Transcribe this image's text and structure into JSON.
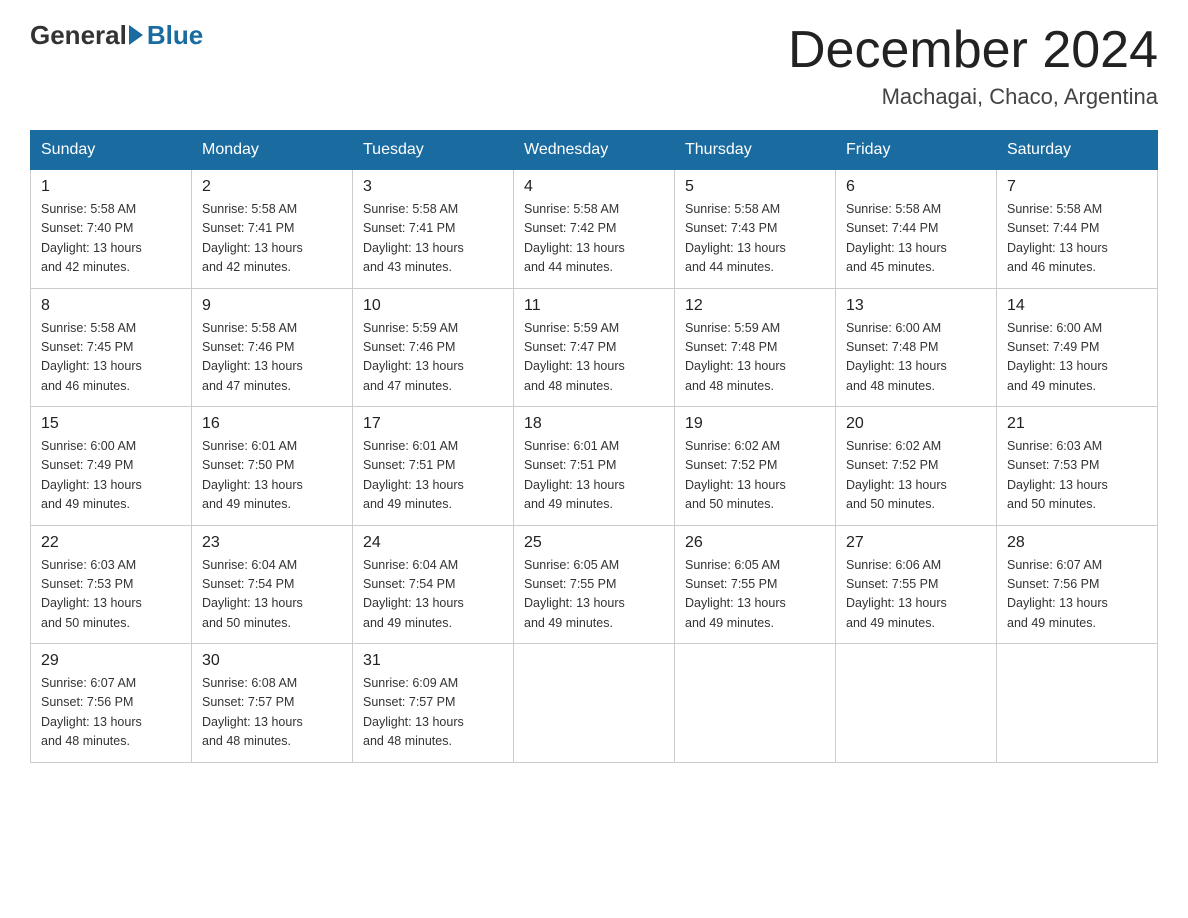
{
  "logo": {
    "general": "General",
    "blue": "Blue"
  },
  "title": {
    "month_year": "December 2024",
    "location": "Machagai, Chaco, Argentina"
  },
  "weekdays": [
    "Sunday",
    "Monday",
    "Tuesday",
    "Wednesday",
    "Thursday",
    "Friday",
    "Saturday"
  ],
  "weeks": [
    [
      {
        "day": "1",
        "sunrise": "5:58 AM",
        "sunset": "7:40 PM",
        "daylight": "13 hours and 42 minutes."
      },
      {
        "day": "2",
        "sunrise": "5:58 AM",
        "sunset": "7:41 PM",
        "daylight": "13 hours and 42 minutes."
      },
      {
        "day": "3",
        "sunrise": "5:58 AM",
        "sunset": "7:41 PM",
        "daylight": "13 hours and 43 minutes."
      },
      {
        "day": "4",
        "sunrise": "5:58 AM",
        "sunset": "7:42 PM",
        "daylight": "13 hours and 44 minutes."
      },
      {
        "day": "5",
        "sunrise": "5:58 AM",
        "sunset": "7:43 PM",
        "daylight": "13 hours and 44 minutes."
      },
      {
        "day": "6",
        "sunrise": "5:58 AM",
        "sunset": "7:44 PM",
        "daylight": "13 hours and 45 minutes."
      },
      {
        "day": "7",
        "sunrise": "5:58 AM",
        "sunset": "7:44 PM",
        "daylight": "13 hours and 46 minutes."
      }
    ],
    [
      {
        "day": "8",
        "sunrise": "5:58 AM",
        "sunset": "7:45 PM",
        "daylight": "13 hours and 46 minutes."
      },
      {
        "day": "9",
        "sunrise": "5:58 AM",
        "sunset": "7:46 PM",
        "daylight": "13 hours and 47 minutes."
      },
      {
        "day": "10",
        "sunrise": "5:59 AM",
        "sunset": "7:46 PM",
        "daylight": "13 hours and 47 minutes."
      },
      {
        "day": "11",
        "sunrise": "5:59 AM",
        "sunset": "7:47 PM",
        "daylight": "13 hours and 48 minutes."
      },
      {
        "day": "12",
        "sunrise": "5:59 AM",
        "sunset": "7:48 PM",
        "daylight": "13 hours and 48 minutes."
      },
      {
        "day": "13",
        "sunrise": "6:00 AM",
        "sunset": "7:48 PM",
        "daylight": "13 hours and 48 minutes."
      },
      {
        "day": "14",
        "sunrise": "6:00 AM",
        "sunset": "7:49 PM",
        "daylight": "13 hours and 49 minutes."
      }
    ],
    [
      {
        "day": "15",
        "sunrise": "6:00 AM",
        "sunset": "7:49 PM",
        "daylight": "13 hours and 49 minutes."
      },
      {
        "day": "16",
        "sunrise": "6:01 AM",
        "sunset": "7:50 PM",
        "daylight": "13 hours and 49 minutes."
      },
      {
        "day": "17",
        "sunrise": "6:01 AM",
        "sunset": "7:51 PM",
        "daylight": "13 hours and 49 minutes."
      },
      {
        "day": "18",
        "sunrise": "6:01 AM",
        "sunset": "7:51 PM",
        "daylight": "13 hours and 49 minutes."
      },
      {
        "day": "19",
        "sunrise": "6:02 AM",
        "sunset": "7:52 PM",
        "daylight": "13 hours and 50 minutes."
      },
      {
        "day": "20",
        "sunrise": "6:02 AM",
        "sunset": "7:52 PM",
        "daylight": "13 hours and 50 minutes."
      },
      {
        "day": "21",
        "sunrise": "6:03 AM",
        "sunset": "7:53 PM",
        "daylight": "13 hours and 50 minutes."
      }
    ],
    [
      {
        "day": "22",
        "sunrise": "6:03 AM",
        "sunset": "7:53 PM",
        "daylight": "13 hours and 50 minutes."
      },
      {
        "day": "23",
        "sunrise": "6:04 AM",
        "sunset": "7:54 PM",
        "daylight": "13 hours and 50 minutes."
      },
      {
        "day": "24",
        "sunrise": "6:04 AM",
        "sunset": "7:54 PM",
        "daylight": "13 hours and 49 minutes."
      },
      {
        "day": "25",
        "sunrise": "6:05 AM",
        "sunset": "7:55 PM",
        "daylight": "13 hours and 49 minutes."
      },
      {
        "day": "26",
        "sunrise": "6:05 AM",
        "sunset": "7:55 PM",
        "daylight": "13 hours and 49 minutes."
      },
      {
        "day": "27",
        "sunrise": "6:06 AM",
        "sunset": "7:55 PM",
        "daylight": "13 hours and 49 minutes."
      },
      {
        "day": "28",
        "sunrise": "6:07 AM",
        "sunset": "7:56 PM",
        "daylight": "13 hours and 49 minutes."
      }
    ],
    [
      {
        "day": "29",
        "sunrise": "6:07 AM",
        "sunset": "7:56 PM",
        "daylight": "13 hours and 48 minutes."
      },
      {
        "day": "30",
        "sunrise": "6:08 AM",
        "sunset": "7:57 PM",
        "daylight": "13 hours and 48 minutes."
      },
      {
        "day": "31",
        "sunrise": "6:09 AM",
        "sunset": "7:57 PM",
        "daylight": "13 hours and 48 minutes."
      },
      null,
      null,
      null,
      null
    ]
  ],
  "labels": {
    "sunrise": "Sunrise:",
    "sunset": "Sunset:",
    "daylight": "Daylight:"
  }
}
